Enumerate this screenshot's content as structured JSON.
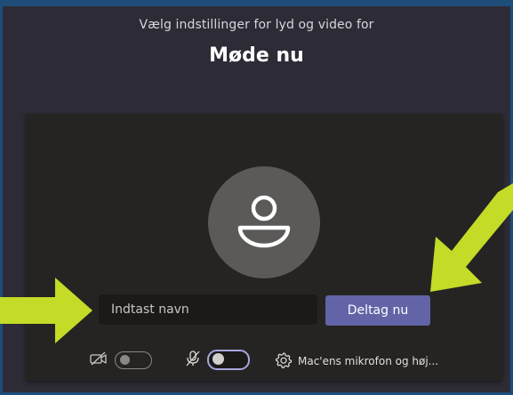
{
  "header": {
    "subtitle": "Vælg indstillinger for lyd og video for",
    "title": "Møde nu"
  },
  "join": {
    "name_placeholder": "Indtast navn",
    "button_label": "Deltag nu"
  },
  "controls": {
    "camera_enabled": false,
    "microphone_enabled": true,
    "device_label": "Mac'ens mikrofon og høj..."
  },
  "colors": {
    "background": "#2d2c36",
    "panel": "#252423",
    "primary_button": "#6264a7",
    "toggle_on_border": "#a6a7dc",
    "annotation_arrow": "#c4db27"
  },
  "icons": [
    "avatar-person-icon",
    "camera-off-icon",
    "mic-off-icon",
    "gear-icon"
  ]
}
